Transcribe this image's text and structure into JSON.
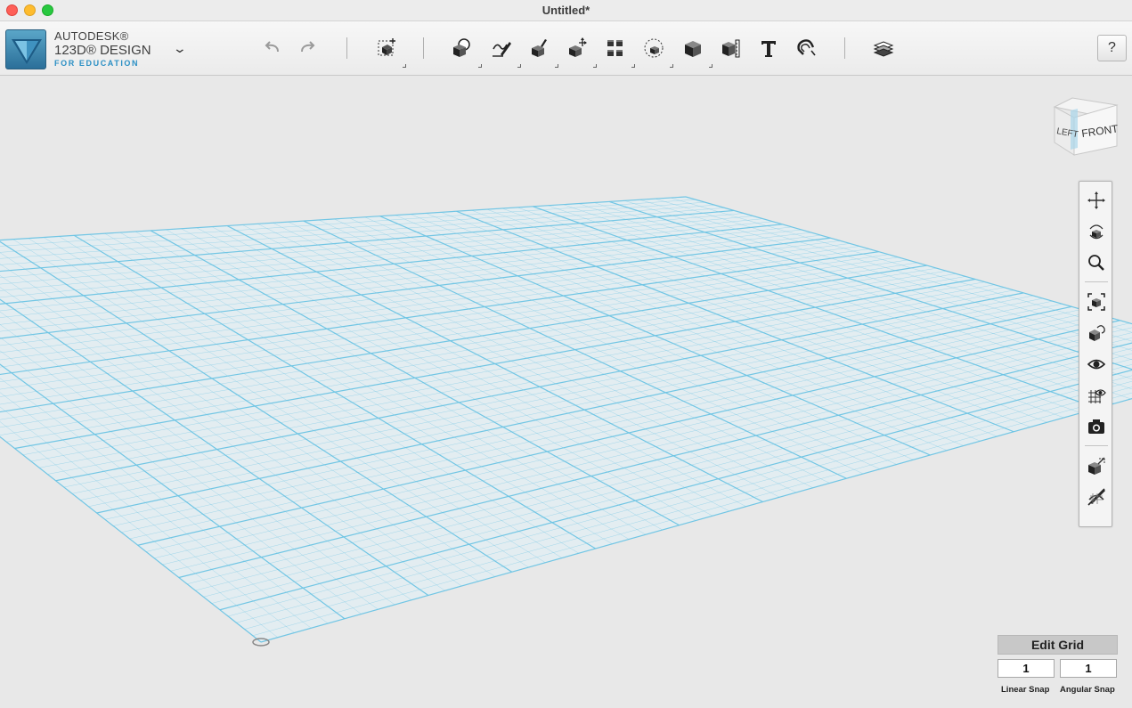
{
  "window": {
    "title": "Untitled*"
  },
  "app": {
    "brand_line1": "AUTODESK®",
    "brand_line2": "123D® DESIGN",
    "brand_line3": "FOR EDUCATION"
  },
  "toolbar": {
    "items": [
      {
        "name": "undo-icon"
      },
      {
        "name": "redo-icon"
      },
      {
        "name": "transform-icon"
      },
      {
        "name": "primitives-icon"
      },
      {
        "name": "sketch-icon"
      },
      {
        "name": "construct-icon"
      },
      {
        "name": "modify-icon"
      },
      {
        "name": "pattern-icon"
      },
      {
        "name": "group-icon"
      },
      {
        "name": "combine-icon"
      },
      {
        "name": "measure-icon"
      },
      {
        "name": "text-icon"
      },
      {
        "name": "snap-icon"
      },
      {
        "name": "materials-icon"
      }
    ],
    "help_label": "?"
  },
  "viewcube": {
    "left_label": "LEFT",
    "front_label": "FRONT"
  },
  "navbar": {
    "items": [
      "pan-icon",
      "orbit-icon",
      "zoom-icon",
      "fit-icon",
      "orbit-selected-icon",
      "visibility-icon",
      "grid-visibility-icon",
      "screenshot-icon",
      "materials-outline-icon",
      "hide-sketch-icon"
    ]
  },
  "edit_grid": {
    "button_label": "Edit Grid",
    "linear_snap_value": "1",
    "angular_snap_value": "1",
    "linear_snap_label": "Linear Snap",
    "angular_snap_label": "Angular Snap"
  },
  "colors": {
    "grid_line": "#6cc4e4",
    "grid_fill": "#dff0f6",
    "background": "#e8e8e8"
  }
}
